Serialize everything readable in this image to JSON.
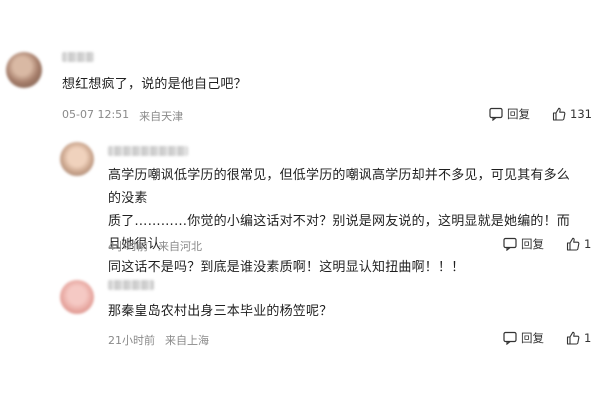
{
  "comments": [
    {
      "text": "想红想疯了，说的是他自己吧？",
      "date": "05-07 12:51",
      "location": "来自天津",
      "reply_label": "回复",
      "like_count": "131"
    },
    {
      "text_lines": [
        "高学历嘲讽低学历的很常见，但低学历的嘲讽高学历却并不多见，可见其有多么的没素",
        "质了…………你觉的小编这话对不对？别说是网友说的，这明显就是她编的！而且她很认",
        "同这话不是吗？到底是谁没素质啊！这明显认知扭曲啊！！！"
      ],
      "date": "4小时前",
      "location": "来自河北",
      "reply_label": "回复",
      "like_count": "1"
    },
    {
      "text": "那秦皇岛农村出身三本毕业的杨笠呢？",
      "date": "21小时前",
      "location": "来自上海",
      "reply_label": "回复",
      "like_count": "1"
    }
  ],
  "icons": {
    "reply": "reply-icon",
    "like": "thumbs-up-icon"
  }
}
